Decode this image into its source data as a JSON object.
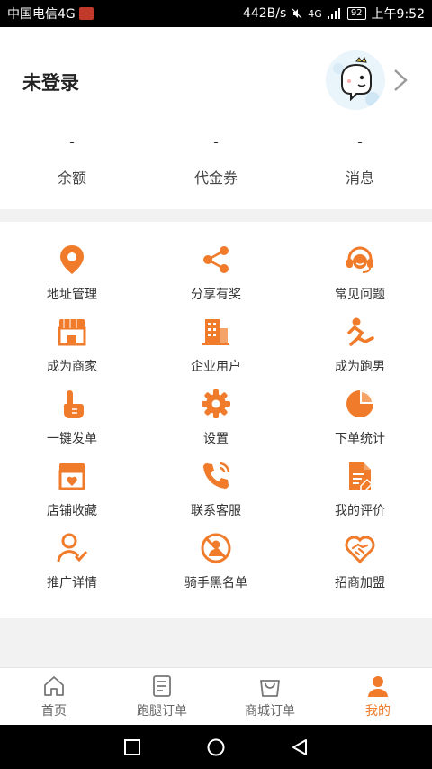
{
  "status_bar": {
    "carrier": "中国电信4G",
    "speed": "442B/s",
    "network": "4G",
    "battery": "92",
    "time": "上午9:52"
  },
  "profile": {
    "login_text": "未登录",
    "stats": [
      {
        "value": "-",
        "label": "余额"
      },
      {
        "value": "-",
        "label": "代金券"
      },
      {
        "value": "-",
        "label": "消息"
      }
    ]
  },
  "menu": {
    "items": [
      {
        "label": "地址管理",
        "icon": "location-pin-icon"
      },
      {
        "label": "分享有奖",
        "icon": "share-icon"
      },
      {
        "label": "常见问题",
        "icon": "headset-icon"
      },
      {
        "label": "成为商家",
        "icon": "store-icon"
      },
      {
        "label": "企业用户",
        "icon": "building-icon"
      },
      {
        "label": "成为跑男",
        "icon": "runner-icon"
      },
      {
        "label": "一键发单",
        "icon": "tap-hand-icon"
      },
      {
        "label": "设置",
        "icon": "gear-icon"
      },
      {
        "label": "下单统计",
        "icon": "pie-chart-icon"
      },
      {
        "label": "店铺收藏",
        "icon": "store-heart-icon"
      },
      {
        "label": "联系客服",
        "icon": "phone-icon"
      },
      {
        "label": "我的评价",
        "icon": "document-edit-icon"
      },
      {
        "label": "推广详情",
        "icon": "user-check-icon"
      },
      {
        "label": "骑手黑名单",
        "icon": "blocked-user-icon"
      },
      {
        "label": "招商加盟",
        "icon": "handshake-heart-icon"
      }
    ]
  },
  "tabbar": {
    "items": [
      {
        "label": "首页",
        "icon": "home-icon",
        "active": false
      },
      {
        "label": "跑腿订单",
        "icon": "order-list-icon",
        "active": false
      },
      {
        "label": "商城订单",
        "icon": "shopping-bag-icon",
        "active": false
      },
      {
        "label": "我的",
        "icon": "person-icon",
        "active": true
      }
    ]
  },
  "colors": {
    "accent": "#f07b2a",
    "text": "#333333",
    "background": "#f2f2f2"
  }
}
